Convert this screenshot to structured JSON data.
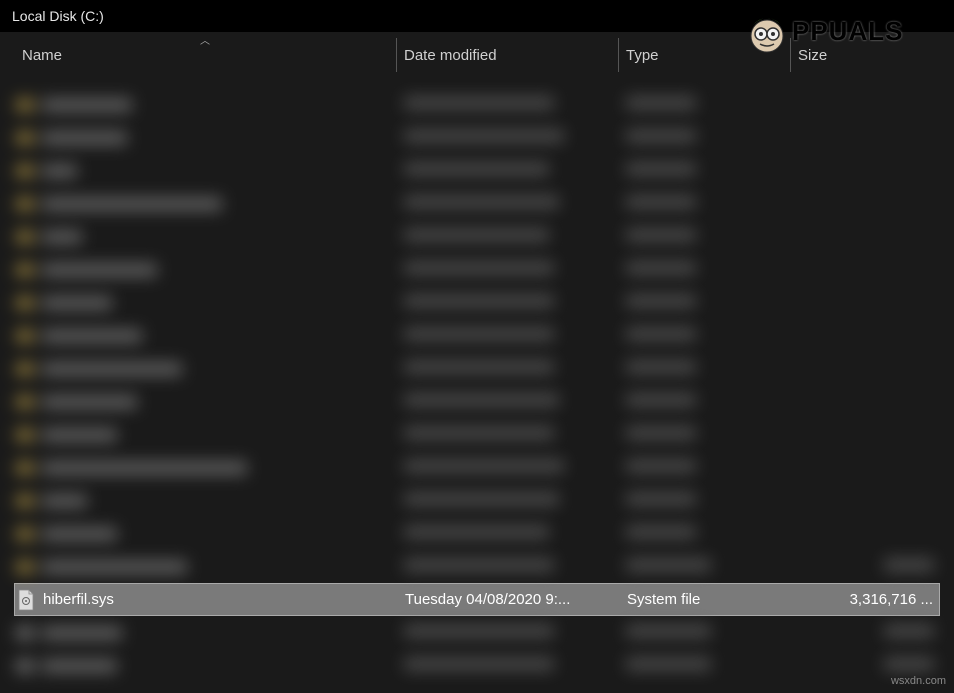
{
  "window": {
    "title": "Local Disk (C:)"
  },
  "columns": {
    "name": "Name",
    "date": "Date modified",
    "type": "Type",
    "size": "Size",
    "sorted_by": "name",
    "sort_direction": "asc"
  },
  "selected_file": {
    "name": "hiberfil.sys",
    "date": "Tuesday 04/08/2020 9:...",
    "type": "System file",
    "size": "3,316,716 ..."
  },
  "watermark": {
    "brand": "PPUALS",
    "site": "wsxdn.com"
  }
}
